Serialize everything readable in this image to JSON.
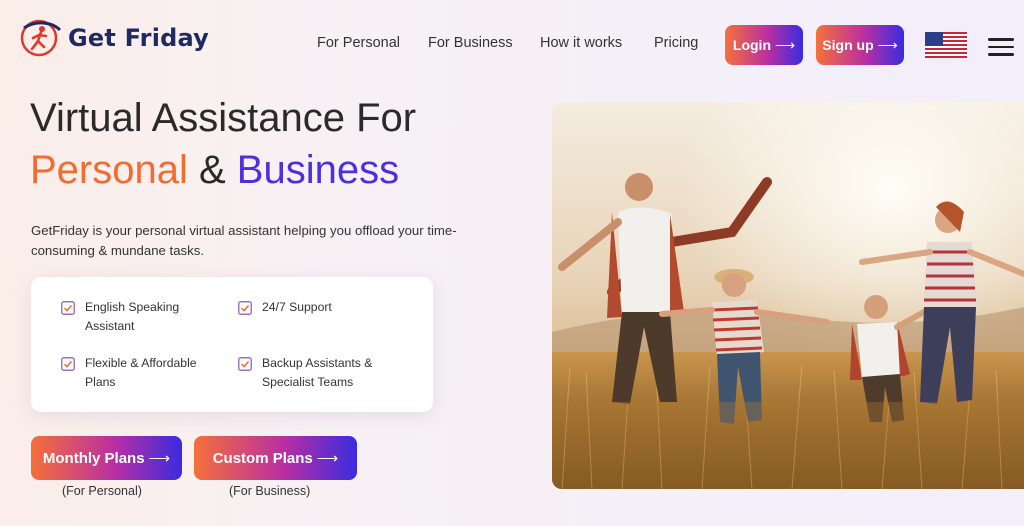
{
  "brand": {
    "name": "Get Friday",
    "logo_icon": "running-person-logo"
  },
  "nav": {
    "items": [
      "For Personal",
      "For Business",
      "How it works",
      "Pricing"
    ]
  },
  "header_buttons": {
    "login": "Login",
    "signup": "Sign up",
    "arrow": "⟶"
  },
  "flag_icon": "us-flag-icon",
  "menu_icon": "hamburger-icon",
  "hero": {
    "line1": "Virtual Assistance For",
    "word_personal": "Personal",
    "amp": " & ",
    "word_business": "Business",
    "description": "GetFriday is your personal virtual assistant helping you offload your time-consuming & mundane tasks."
  },
  "features": [
    "English Speaking Assistant",
    "24/7 Support",
    "Flexible & Affordable Plans",
    "Backup Assistants & Specialist Teams"
  ],
  "cta": {
    "monthly": "Monthly Plans",
    "monthly_sub": "(For Personal)",
    "custom": "Custom Plans",
    "custom_sub": "(For Business)"
  },
  "colors": {
    "orange": "#f26c2f",
    "purple": "#4b2fe0",
    "navy": "#1f2a63"
  }
}
